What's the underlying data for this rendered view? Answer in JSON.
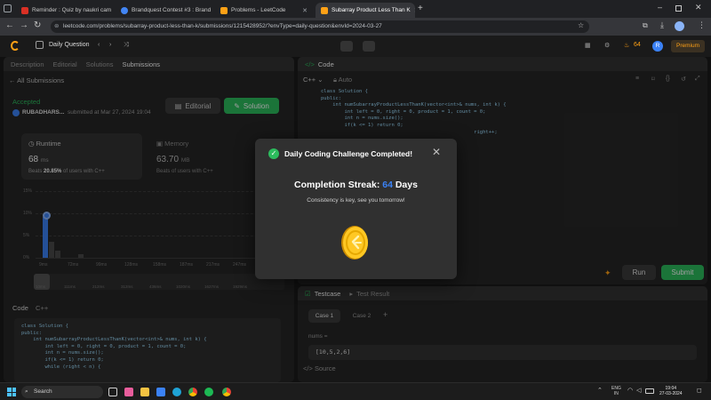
{
  "browser": {
    "tabs": [
      {
        "title": "Reminder : Quiz by naukri cam",
        "color": "#d93025"
      },
      {
        "title": "Brandquest Contest #3 : Brand",
        "color": "#4285f4"
      },
      {
        "title": "Problems - LeetCode",
        "color": "#ffa116"
      },
      {
        "title": "Subarray Product Less Than K",
        "color": "#ffa116"
      }
    ],
    "url": "leetcode.com/problems/subarray-product-less-than-k/submissions/1215428952/?envType=daily-question&envId=2024-03-27"
  },
  "nav": {
    "daily_label": "Daily Question",
    "streak_count": "64",
    "avatar_letter": "R",
    "premium_label": "Premium"
  },
  "left": {
    "tabs": [
      "Description",
      "Editorial",
      "Solutions",
      "Submissions"
    ],
    "all_submissions": "All Submissions",
    "status": "Accepted",
    "user": "RUBADHARS...",
    "submitted": "submitted at Mar 27, 2024 19:04",
    "editorial_btn": "Editorial",
    "solution_btn": "Solution",
    "runtime_label": "Runtime",
    "runtime_value": "68",
    "runtime_unit": "ms",
    "runtime_beats_prefix": "Beats",
    "runtime_beats_pct": "20.85%",
    "runtime_beats_suffix": "of users with C++",
    "memory_label": "Memory",
    "memory_value": "63.70",
    "memory_unit": "MB",
    "memory_beats_prefix": "Beats",
    "memory_beats_suffix": "of users with C++",
    "chart_y_labels": [
      "15%",
      "10%",
      "5%",
      "0%"
    ],
    "chart_x_labels": [
      "9ms",
      "72ms",
      "99ms",
      "128ms",
      "158ms",
      "187ms",
      "217ms",
      "247ms"
    ],
    "mini_x_labels": [
      "10ms",
      "111ms",
      "212ms",
      "312ms",
      "436ms",
      "1020ms",
      "1627ms",
      "1929ms"
    ],
    "code_label": "Code",
    "code_lang": "C++",
    "code_lines": [
      "class Solution {",
      "public:",
      "    int numSubarrayProductLessThanK(vector<int>& nums, int k) {",
      "        int left = 0, right = 0, product = 1, count = 0;",
      "        int n = nums.size();",
      "        if(k <= 1) return 0;",
      "        while (right < n) {"
    ]
  },
  "right": {
    "code_tab": "Code",
    "lang": "C++",
    "auto": "Auto",
    "code_lines": [
      "class Solution {",
      "public:",
      "    int numSubarrayProductLessThanK(vector<int>& nums, int k) {",
      "        int left = 0, right = 0, product = 1, count = 0;",
      "        int n = nums.size();",
      "        if(k <= 1) return 0;",
      "",
      "",
      "                                                    right++;",
      "",
      "",
      ""
    ],
    "run_btn": "Run",
    "submit_btn": "Submit",
    "test_tabs": [
      "Testcase",
      "Test Result"
    ],
    "cases": [
      "Case 1",
      "Case 2"
    ],
    "nums_label": "nums =",
    "nums_value": "[10,5,2,6]",
    "source_label": "Source"
  },
  "modal": {
    "title": "Daily Coding Challenge Completed!",
    "streak_prefix": "Completion Streak:",
    "streak_value": "64",
    "streak_suffix": "Days",
    "message": "Consistency is key, see you tomorrow!"
  },
  "taskbar": {
    "search": "Search",
    "lang_top": "ENG",
    "lang_bottom": "IN",
    "time": "19:04",
    "date": "27-03-2024"
  },
  "colors": {
    "accent": "#ffa116",
    "green": "#2cbb5d",
    "blue": "#3b82f6"
  }
}
